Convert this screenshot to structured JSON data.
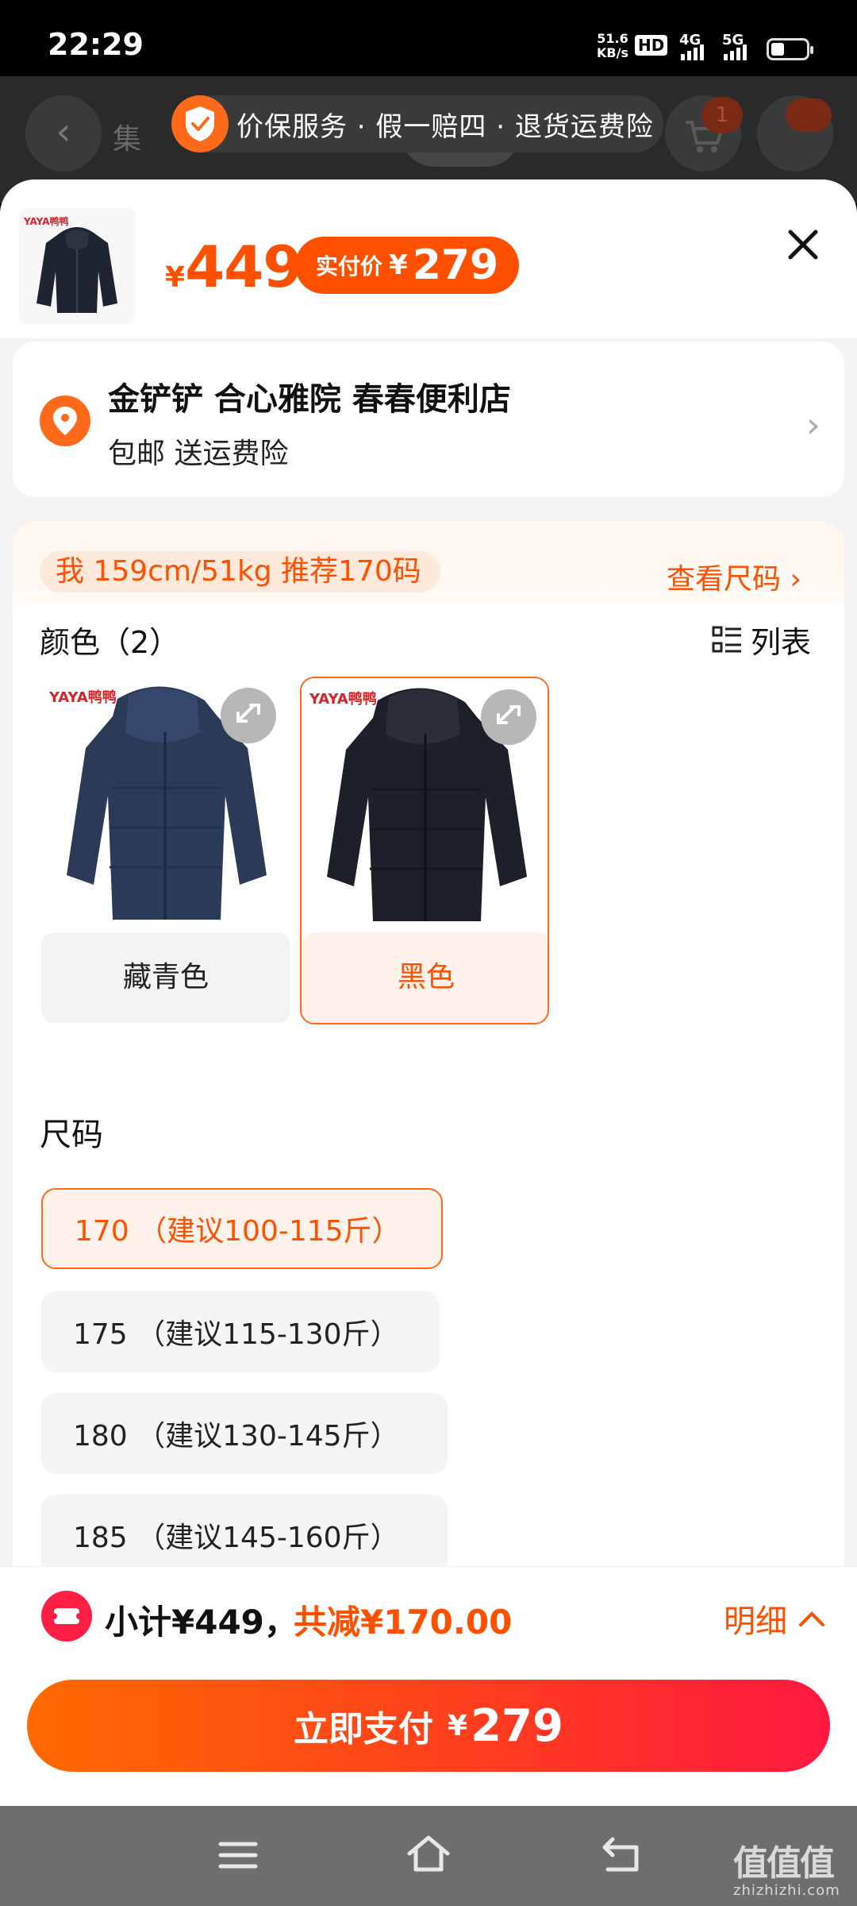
{
  "status_bar": {
    "time": "22:29",
    "net_rate_value": "51.6",
    "net_rate_unit": "KB/s",
    "hd_label": "HD",
    "signal_4g": "4G",
    "signal_5g": "5G"
  },
  "background_page": {
    "tab_partial": "集",
    "cart_badge": "1"
  },
  "service_banner": {
    "text": "价保服务 · 假一赔四 · 退货运费险",
    "icon": "shield-check-icon"
  },
  "product": {
    "price_currency": "¥",
    "price": "449",
    "paid_label": "实付价",
    "paid_currency": "¥",
    "paid_price": "279",
    "thumb_brand": "YAYA鸭鸭"
  },
  "address": {
    "title": "金铲铲 合心雅院 春春便利店",
    "subtitle": "包邮 送运费险"
  },
  "recommendation": {
    "text": "我 159cm/51kg 推荐170码",
    "size_chart_link": "查看尺码 ›"
  },
  "color_section": {
    "title": "颜色（2）",
    "list_button": "列表",
    "options": [
      {
        "label": "藏青色",
        "brand": "YAYA鸭鸭",
        "selected": false
      },
      {
        "label": "黑色",
        "brand": "YAYA鸭鸭",
        "selected": true
      }
    ]
  },
  "size_section": {
    "title": "尺码",
    "options": [
      {
        "label": "170 （建议100-115斤）",
        "selected": true
      },
      {
        "label": "175 （建议115-130斤）",
        "selected": false
      },
      {
        "label": "180 （建议130-145斤）",
        "selected": false
      },
      {
        "label": "185 （建议145-160斤）",
        "selected": false
      }
    ]
  },
  "summary": {
    "subtotal": "小计¥449，",
    "discount": "共减¥170.00",
    "detail_link": "明细"
  },
  "pay_button": {
    "label": "立即支付",
    "currency": "¥",
    "amount": "279"
  },
  "watermark": {
    "main": "值值值",
    "sub": "zhizhizhi.com"
  },
  "colors": {
    "accent": "#ff5000",
    "accent_light": "#fff2ea",
    "pay_gradient_end": "#ff1840"
  }
}
